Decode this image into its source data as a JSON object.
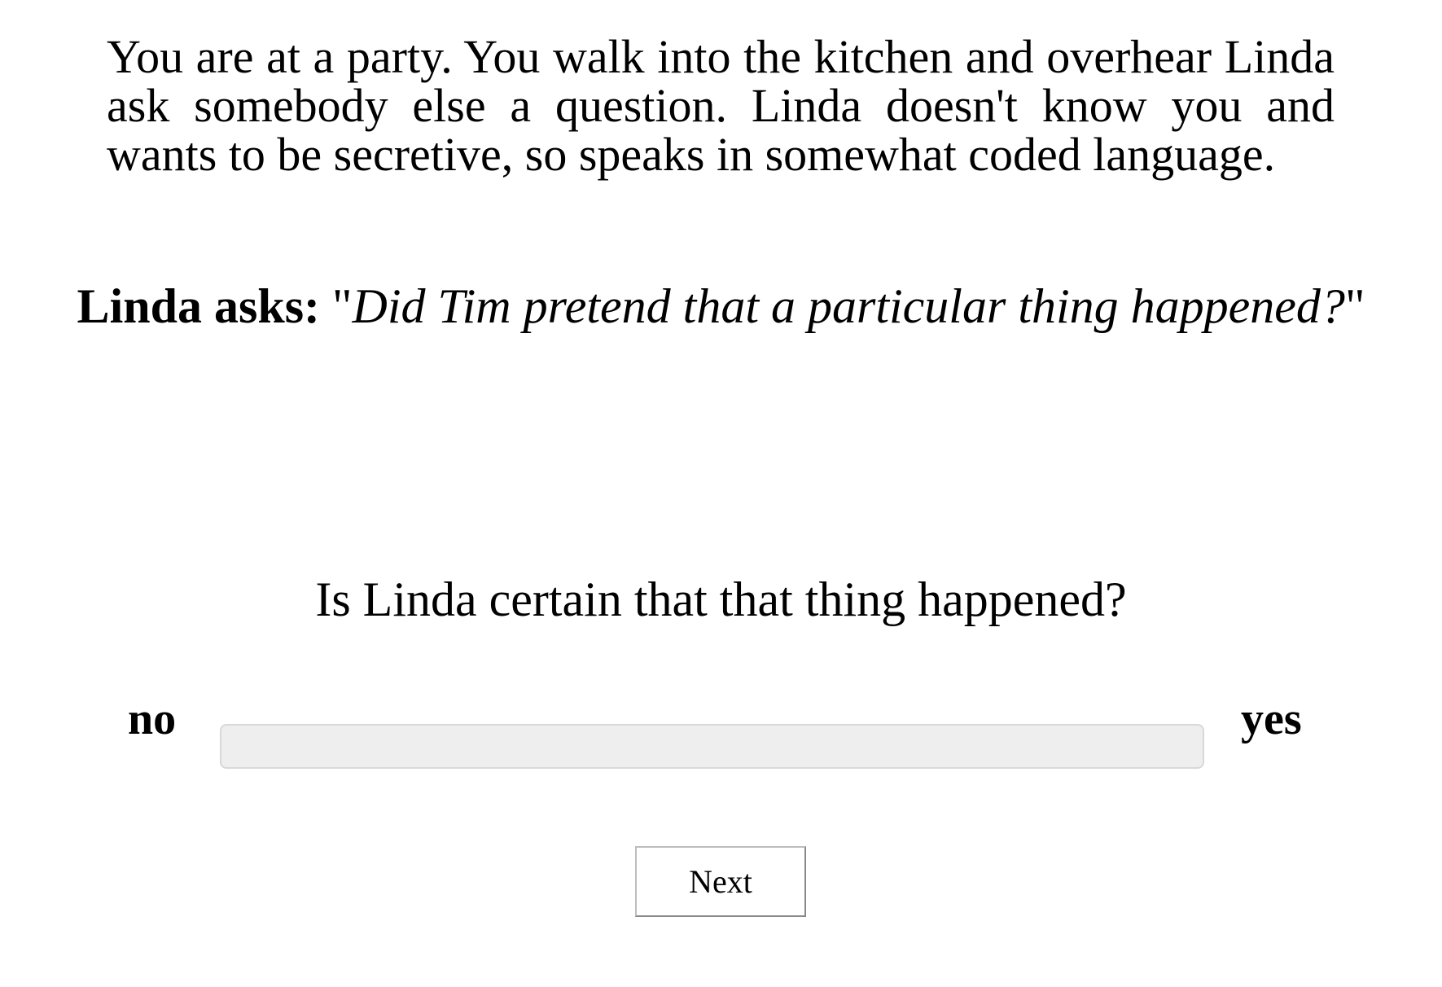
{
  "context": {
    "text": "You are at a party. You walk into the kitchen and overhear Linda ask somebody else a question. Linda doesn't know you and wants to be secretive, so speaks in somewhat coded language."
  },
  "prompt": {
    "speaker_label": "Linda asks:",
    "quote_open": "\"",
    "quote_text": "Did Tim pretend that a particular thing happened?",
    "quote_close": "\""
  },
  "question": {
    "text": "Is Linda certain that that thing happened?"
  },
  "slider": {
    "min_label": "no",
    "max_label": "yes",
    "value": null
  },
  "navigation": {
    "next_label": "Next"
  }
}
